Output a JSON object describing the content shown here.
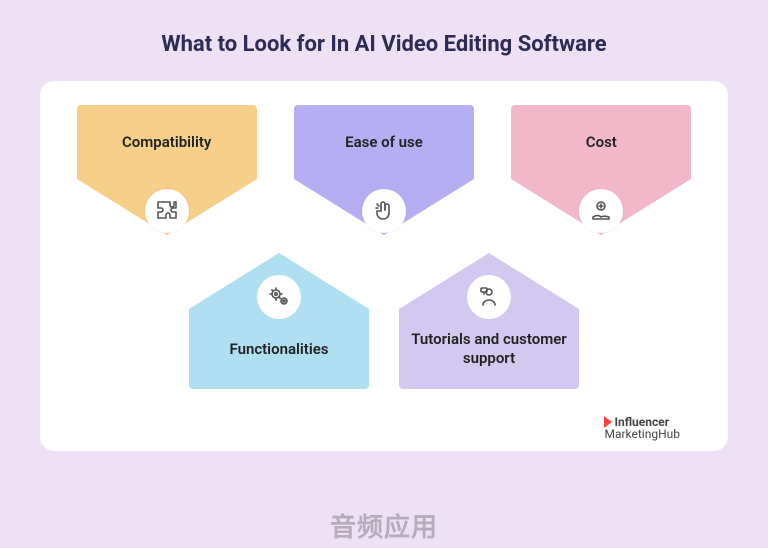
{
  "title": "What to Look for In AI Video Editing Software",
  "row1": [
    {
      "label": "Compatibility",
      "icon": "puzzle"
    },
    {
      "label": "Ease of use",
      "icon": "snap"
    },
    {
      "label": "Cost",
      "icon": "coin-hand"
    }
  ],
  "row2": [
    {
      "label": "Functionalities",
      "icon": "gears"
    },
    {
      "label": "Tutorials and customer support",
      "icon": "support"
    }
  ],
  "brand": {
    "line1": "Influencer",
    "line2": "MarketingHub"
  },
  "watermark": "音频应用",
  "colors": {
    "page_bg": "#eee0f5",
    "card_bg": "#ffffff",
    "yellow": "#f6d089",
    "purple": "#b6aef2",
    "pink": "#f2b8c9",
    "blue": "#b0dff2",
    "lilac": "#d3c8ef",
    "brand_accent": "#f8423a"
  }
}
